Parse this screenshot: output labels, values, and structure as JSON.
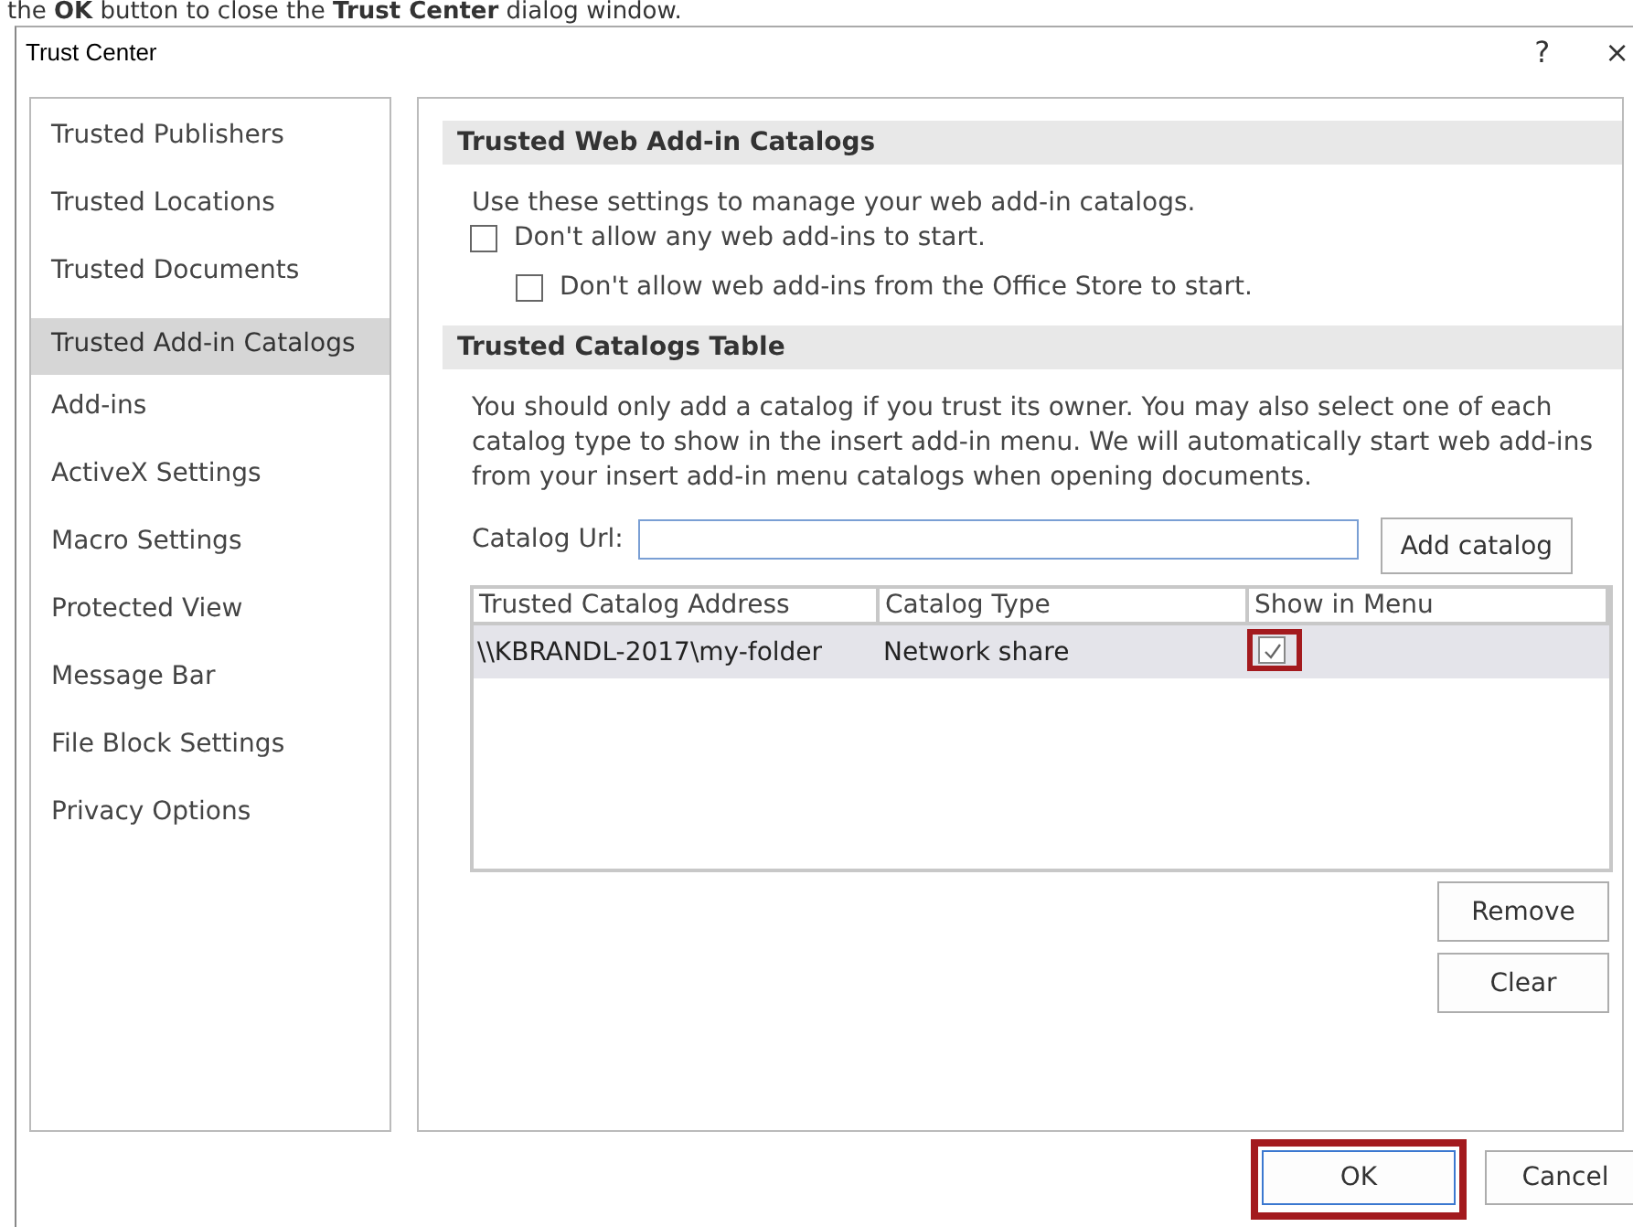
{
  "caption": "the **OK** button to close the **Trust Center** dialog window.",
  "window": {
    "title": "Trust Center",
    "help": "?",
    "close": "×"
  },
  "sidebar": {
    "items": [
      {
        "label": "Trusted Publishers",
        "selected": false
      },
      {
        "label": "Trusted Locations",
        "selected": false
      },
      {
        "label": "Trusted Documents",
        "selected": false
      },
      {
        "label": "Trusted Add-in Catalogs",
        "selected": true
      },
      {
        "label": "Add-ins",
        "selected": false
      },
      {
        "label": "ActiveX Settings",
        "selected": false
      },
      {
        "label": "Macro Settings",
        "selected": false
      },
      {
        "label": "Protected View",
        "selected": false
      },
      {
        "label": "Message Bar",
        "selected": false
      },
      {
        "label": "File Block Settings",
        "selected": false
      },
      {
        "label": "Privacy Options",
        "selected": false
      }
    ]
  },
  "web_section": {
    "title": "Trusted Web Add-in Catalogs",
    "description": "Use these settings to manage your web add-in catalogs.",
    "options": [
      {
        "label": "Don't allow any web add-ins to start.",
        "checked": false,
        "children": [
          {
            "label": "Don't allow web add-ins from the Office Store to start.",
            "checked": false
          }
        ]
      }
    ]
  },
  "catalog_section": {
    "title": "Trusted Catalogs Table",
    "description": "You should only add a catalog if you trust its owner. You may also select one of each catalog type to show in the insert add-in menu. We will automatically start web add-ins from your insert add-in menu catalogs when opening documents.",
    "url_label": "Catalog Url:",
    "add_button": "Add catalog",
    "table": {
      "columns": [
        "Trusted Catalog Address",
        "Catalog Type",
        "Show in Menu"
      ],
      "rows": [
        {
          "address": "\\\\KBRANDL-2017\\my-folder",
          "type": "Network share",
          "show_in_menu": true,
          "selected": true,
          "highlighted": true
        }
      ]
    },
    "side_buttons": [
      "Remove",
      "Clear"
    ]
  },
  "footer": {
    "buttons": [
      {
        "label": "OK",
        "highlighted": true,
        "default": true
      },
      {
        "label": "Cancel",
        "highlighted": false,
        "default": false
      }
    ]
  }
}
